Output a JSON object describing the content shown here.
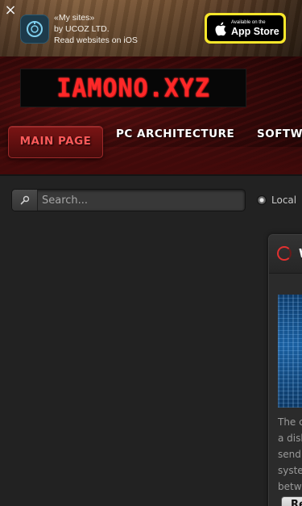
{
  "app_banner": {
    "close_glyph": "×",
    "app_name": "«My sites»",
    "publisher": "by UCOZ LTD.",
    "tagline": "Read websites on iOS",
    "store_button": {
      "small_text": "Available on the",
      "big_text": "App Store",
      "accent_color": "#f7e62a"
    }
  },
  "header": {
    "logo_text": "IAMONO.XYZ",
    "logo_color": "#ff2828",
    "nav": [
      {
        "label": "MAIN PAGE",
        "active": true
      },
      {
        "label": "PC ARCHITECTURE",
        "active": false
      },
      {
        "label": "SOFTW",
        "active": false
      }
    ]
  },
  "search": {
    "placeholder": "Search...",
    "value": "",
    "scope_option": "Local"
  },
  "card": {
    "title": "W",
    "text_lines": [
      "The c",
      "a disk",
      "send",
      "syste",
      "betw"
    ],
    "button_label": "Re"
  }
}
